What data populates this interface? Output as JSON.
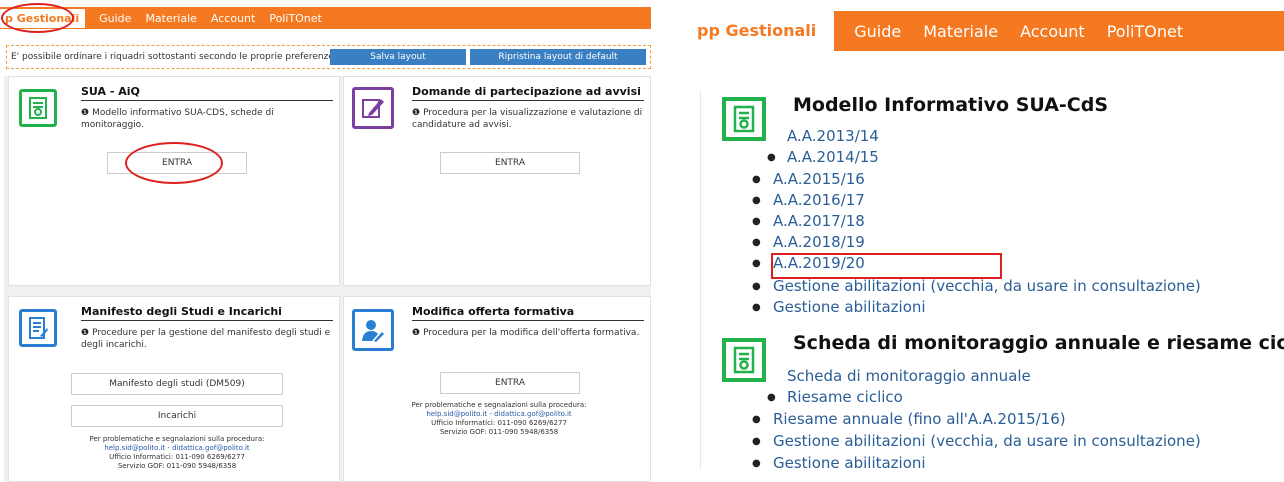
{
  "left": {
    "nav": {
      "items": [
        "p Gestionali",
        "Guide",
        "Materiale",
        "Account",
        "PoliTOnet"
      ]
    },
    "layout": {
      "message": "E' possibile ordinare i riquadri sottostanti secondo le proprie preferenze...",
      "save_label": "Salva layout",
      "reset_label": "Ripristina layout di default"
    },
    "cards": {
      "sua": {
        "title": "SUA - AiQ",
        "desc": "Modello informativo SUA-CDS, schede di monitoraggio.",
        "button": "ENTRA"
      },
      "domande": {
        "title": "Domande di partecipazione ad avvisi",
        "desc": "Procedura per la visualizzazione e valutazione di candidature ad avvisi.",
        "button": "ENTRA"
      },
      "manifesto": {
        "title": "Manifesto degli Studi e Incarichi",
        "desc": "Procedure per la gestione del manifesto degli studi e degli incarichi.",
        "button1": "Manifesto degli studi (DM509)",
        "button2": "Incarichi",
        "foot1": "Per problematiche e segnalazioni sulla procedura:",
        "foot2": "help.sid@polito.it - didattica.gof@polito.it",
        "foot3": "Ufficio Informatici: 011-090 6269/6277",
        "foot4": "Servizio GOF: 011-090 5948/6358"
      },
      "modifica": {
        "title": "Modifica offerta formativa",
        "desc": "Procedura per la modifica dell'offerta formativa.",
        "button": "ENTRA",
        "foot1": "Per problematiche e segnalazioni sulla procedura:",
        "foot2": "help.sid@polito.it - didattica.gof@polito.it",
        "foot3": "Ufficio Informatici: 011-090 6269/6277",
        "foot4": "Servizio GOF: 011-090 5948/6358"
      }
    }
  },
  "right": {
    "nav": {
      "items": [
        "pp Gestionali",
        "Guide",
        "Materiale",
        "Account",
        "PoliTOnet"
      ]
    },
    "section1": {
      "title": "Modello Informativo SUA-CdS",
      "links": [
        "A.A.2013/14",
        "A.A.2014/15",
        "A.A.2015/16",
        "A.A.2016/17",
        "A.A.2017/18",
        "A.A.2018/19",
        "A.A.2019/20",
        "Gestione abilitazioni (vecchia, da usare in consultazione)",
        "Gestione abilitazioni"
      ]
    },
    "section2": {
      "title": "Scheda di monitoraggio annuale e riesame ciclic",
      "links": [
        "Scheda di monitoraggio annuale",
        "Riesame ciclico",
        "Riesame annuale (fino all'A.A.2015/16)",
        "Gestione abilitazioni (vecchia, da usare in consultazione)",
        "Gestione abilitazioni"
      ]
    }
  }
}
